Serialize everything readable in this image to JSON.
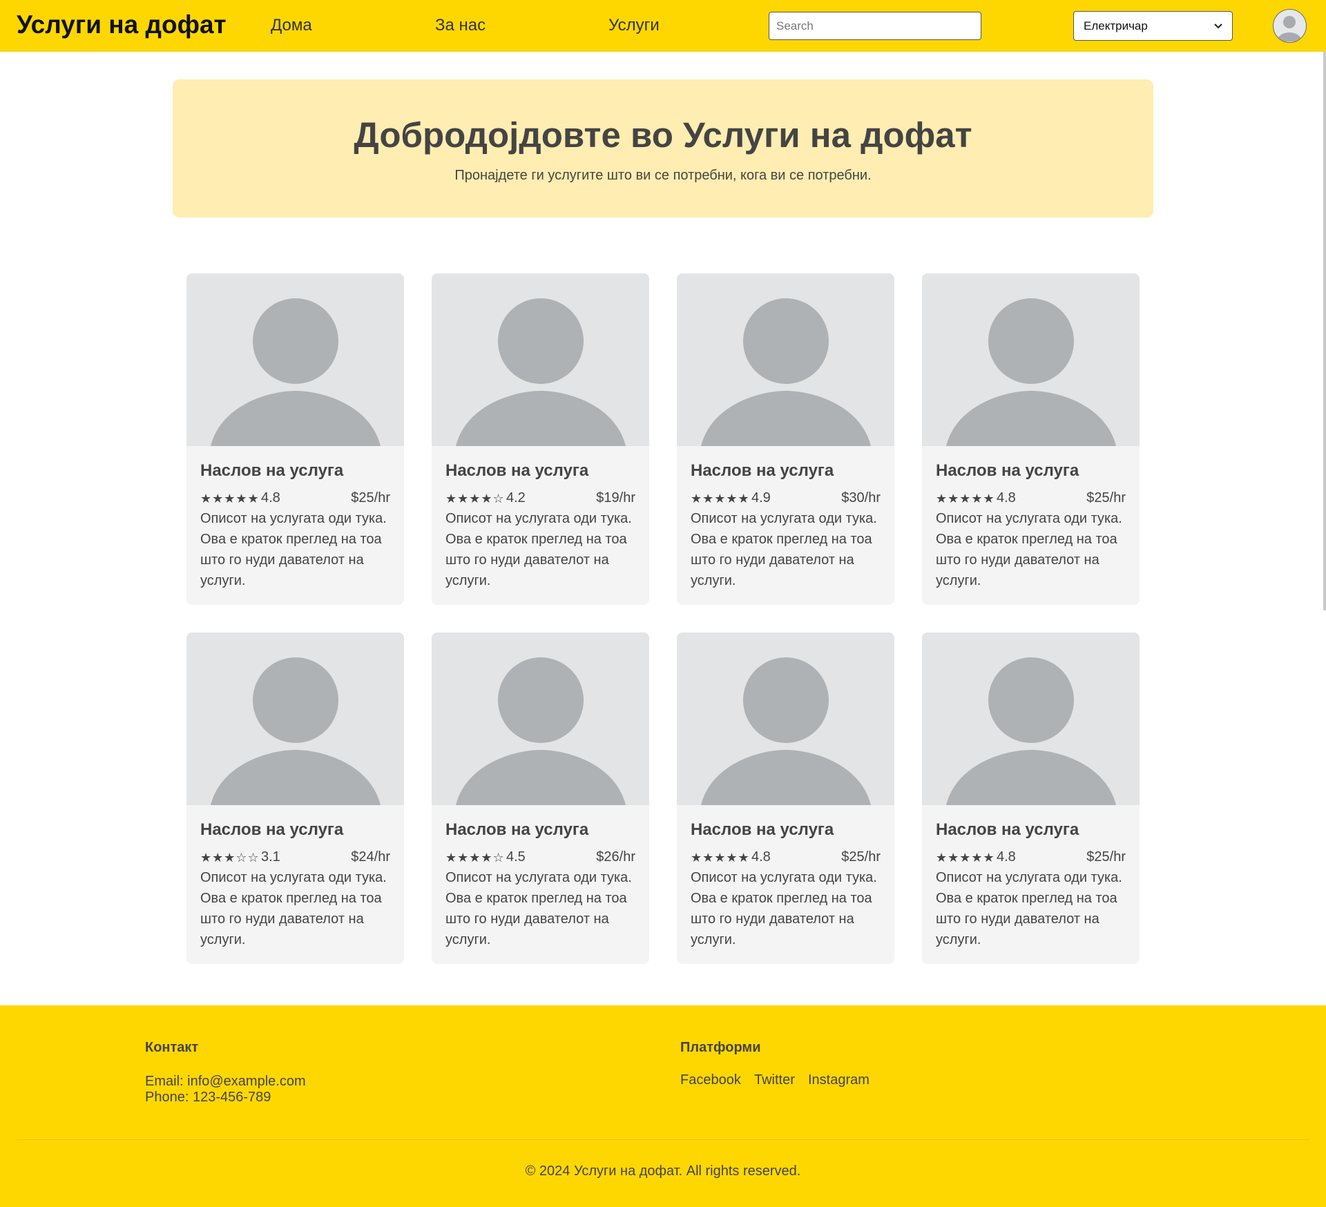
{
  "header": {
    "brand": "Услуги на дофат",
    "nav": [
      "Дома",
      "За нас",
      "Услуги"
    ],
    "search_placeholder": "Search",
    "category_selected": "Електричар",
    "accent_color": "#ffd700"
  },
  "hero": {
    "title": "Добродојдовте во Услуги на дофат",
    "subtitle": "Пронајдете ги услугите што ви се потребни, кога ви се потребни."
  },
  "cards": [
    {
      "title": "Наслов на услуга",
      "stars": "★★★★★",
      "rating": "4.8",
      "rating_value": 4.8,
      "price": "$25/hr",
      "desc": "Описот на услугата оди тука. Ова е краток преглед на тоа што го нуди давателот на услуги."
    },
    {
      "title": "Наслов на услуга",
      "stars": "★★★★☆",
      "rating": "4.2",
      "rating_value": 4.2,
      "price": "$19/hr",
      "desc": "Описот на услугата оди тука. Ова е краток преглед на тоа што го нуди давателот на услуги."
    },
    {
      "title": "Наслов на услуга",
      "stars": "★★★★★",
      "rating": "4.9",
      "rating_value": 4.9,
      "price": "$30/hr",
      "desc": "Описот на услугата оди тука. Ова е краток преглед на тоа што го нуди давателот на услуги."
    },
    {
      "title": "Наслов на услуга",
      "stars": "★★★★★",
      "rating": "4.8",
      "rating_value": 4.8,
      "price": "$25/hr",
      "desc": "Описот на услугата оди тука. Ова е краток преглед на тоа што го нуди давателот на услуги."
    },
    {
      "title": "Наслов на услуга",
      "stars": "★★★☆☆",
      "rating": "3.1",
      "rating_value": 3.1,
      "price": "$24/hr",
      "desc": "Описот на услугата оди тука. Ова е краток преглед на тоа што го нуди давателот на услуги."
    },
    {
      "title": "Наслов на услуга",
      "stars": "★★★★☆",
      "rating": "4.5",
      "rating_value": 4.5,
      "price": "$26/hr",
      "desc": "Описот на услугата оди тука. Ова е краток преглед на тоа што го нуди давателот на услуги."
    },
    {
      "title": "Наслов на услуга",
      "stars": "★★★★★",
      "rating": "4.8",
      "rating_value": 4.8,
      "price": "$25/hr",
      "desc": "Описот на услугата оди тука. Ова е краток преглед на тоа што го нуди давателот на услуги."
    },
    {
      "title": "Наслов на услуга",
      "stars": "★★★★★",
      "rating": "4.8",
      "rating_value": 4.8,
      "price": "$25/hr",
      "desc": "Описот на услугата оди тука. Ова е краток преглед на тоа што го нуди давателот на услуги."
    }
  ],
  "footer": {
    "contact_heading": "Контакт",
    "email": "Email: info@example.com",
    "phone": "Phone: 123-456-789",
    "platforms_heading": "Платформи",
    "platforms": [
      "Facebook",
      "Twitter",
      "Instagram"
    ],
    "copyright": "© 2024 Услуги на дофат. All rights reserved."
  }
}
